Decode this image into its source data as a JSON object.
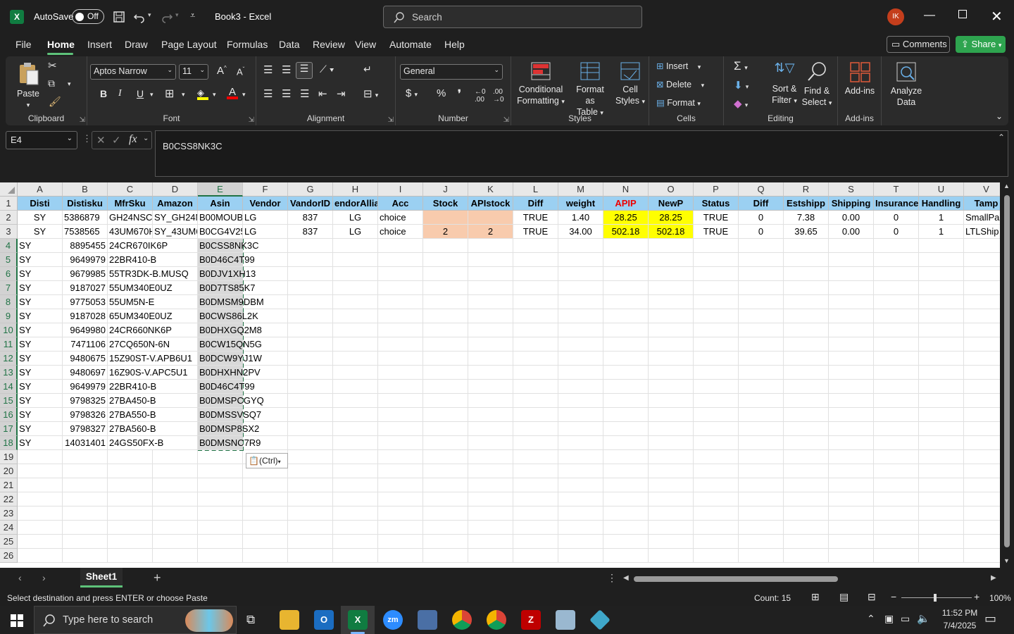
{
  "title": {
    "autosave": "AutoSave",
    "toggle": "Off",
    "doc": "Book3",
    "app": "Excel",
    "search": "Search",
    "avatar": "IK"
  },
  "menu": [
    "File",
    "Home",
    "Insert",
    "Draw",
    "Page Layout",
    "Formulas",
    "Data",
    "Review",
    "View",
    "Automate",
    "Help"
  ],
  "actions": {
    "comments": "Comments",
    "share": "Share"
  },
  "ribbon": {
    "clipboard": {
      "paste": "Paste",
      "label": "Clipboard"
    },
    "font": {
      "name": "Aptos Narrow",
      "size": "11",
      "bold": "B",
      "italic": "I",
      "underline": "U",
      "label": "Font"
    },
    "alignment": {
      "label": "Alignment"
    },
    "number": {
      "format": "General",
      "label": "Number"
    },
    "styles": {
      "conditional": "Conditional",
      "formatting": "Formatting",
      "formatas": "Format as",
      "table": "Table",
      "cell": "Cell",
      "cellstyles": "Styles",
      "label": "Styles"
    },
    "cells": {
      "insert": "Insert",
      "delete": "Delete",
      "format": "Format",
      "label": "Cells"
    },
    "editing": {
      "sort": "Sort &",
      "filter": "Filter",
      "find": "Find &",
      "select": "Select",
      "label": "Editing"
    },
    "addins": {
      "addins": "Add-ins",
      "label": "Add-ins",
      "analyze": "Analyze",
      "data": "Data"
    }
  },
  "namebox": "E4",
  "formula": "B0CSS8NK3C",
  "columns": [
    "A",
    "B",
    "C",
    "D",
    "E",
    "F",
    "G",
    "H",
    "I",
    "J",
    "K",
    "L",
    "M",
    "N",
    "O",
    "P",
    "Q",
    "R",
    "S",
    "T",
    "U",
    "V"
  ],
  "headers": [
    "Disti",
    "Distisku",
    "MfrSku",
    "Amazon",
    "Asin",
    "Vendor",
    "VandorID",
    "endorAllia",
    "Acc",
    "Stock",
    "APIstock",
    "Diff",
    "weight",
    "APIP",
    "NewP",
    "Status",
    "Diff",
    "Estshipp",
    "Shipping",
    "Insurance",
    "Handling",
    "Tamp"
  ],
  "row2": [
    "SY",
    "5386879",
    "GH24NSC0",
    "SY_GH24N",
    "B00MOUB",
    "LG",
    "837",
    "LG",
    "choice",
    "",
    "",
    "TRUE",
    "1.40",
    "28.25",
    "28.25",
    "TRUE",
    "0",
    "7.38",
    "0.00",
    "0",
    "1",
    "SmallPa"
  ],
  "row3": [
    "SY",
    "7538565",
    "43UM670H",
    "SY_43UM6",
    "B0CG4V25",
    "LG",
    "837",
    "LG",
    "choice",
    "2",
    "2",
    "TRUE",
    "34.00",
    "502.18",
    "502.18",
    "TRUE",
    "0",
    "39.65",
    "0.00",
    "0",
    "1",
    "LTLShip"
  ],
  "rows": [
    [
      "SY",
      "8895455",
      "24CR670IK6P",
      "B0CSS8NK3C"
    ],
    [
      "SY",
      "9649979",
      "22BR410-B",
      "B0D46C4T99"
    ],
    [
      "SY",
      "9679985",
      "55TR3DK-B.MUSQ",
      "B0DJV1XH13"
    ],
    [
      "SY",
      "9187027",
      "55UM340E0UZ",
      "B0D7TS85K7"
    ],
    [
      "SY",
      "9775053",
      "55UM5N-E",
      "B0DMSM9DBM"
    ],
    [
      "SY",
      "9187028",
      "65UM340E0UZ",
      "B0CWS86L2K"
    ],
    [
      "SY",
      "9649980",
      "24CR660NK6P",
      "B0DHXGQ2M8"
    ],
    [
      "SY",
      "7471106",
      "27CQ650N-6N",
      "B0CW15QN5G"
    ],
    [
      "SY",
      "9480675",
      "15Z90ST-V.APB6U1",
      "B0DCW9YJ1W"
    ],
    [
      "SY",
      "9480697",
      "16Z90S-V.APC5U1",
      "B0DHXHN2PV"
    ],
    [
      "SY",
      "9649979",
      "22BR410-B",
      "B0D46C4T99"
    ],
    [
      "SY",
      "9798325",
      "27BA450-B",
      "B0DMSPCGYQ"
    ],
    [
      "SY",
      "9798326",
      "27BA550-B",
      "B0DMSSVSQ7"
    ],
    [
      "SY",
      "9798327",
      "27BA560-B",
      "B0DMSP8SX2"
    ],
    [
      "SY",
      "14031401",
      "24GS50FX-B",
      "B0DMSNC7R9"
    ]
  ],
  "rownums": [
    "1",
    "2",
    "3",
    "4",
    "5",
    "6",
    "7",
    "8",
    "9",
    "10",
    "11",
    "12",
    "13",
    "14",
    "15",
    "16",
    "17",
    "18",
    "19",
    "20",
    "21",
    "22",
    "23",
    "24",
    "25",
    "26"
  ],
  "paste_options": "(Ctrl)",
  "sheet": "Sheet1",
  "status": {
    "msg": "Select destination and press ENTER or choose Paste",
    "count": "Count: 15",
    "zoom": "100%"
  },
  "taskbar": {
    "search": "Type here to search",
    "time": "11:52 PM",
    "date": "7/4/2025"
  },
  "colors": {
    "header_fill": "#9bd0f2",
    "salmon": "#f8cbad",
    "yellow": "#ffff00",
    "share": "#2ea44f",
    "excel": "#107c41"
  }
}
